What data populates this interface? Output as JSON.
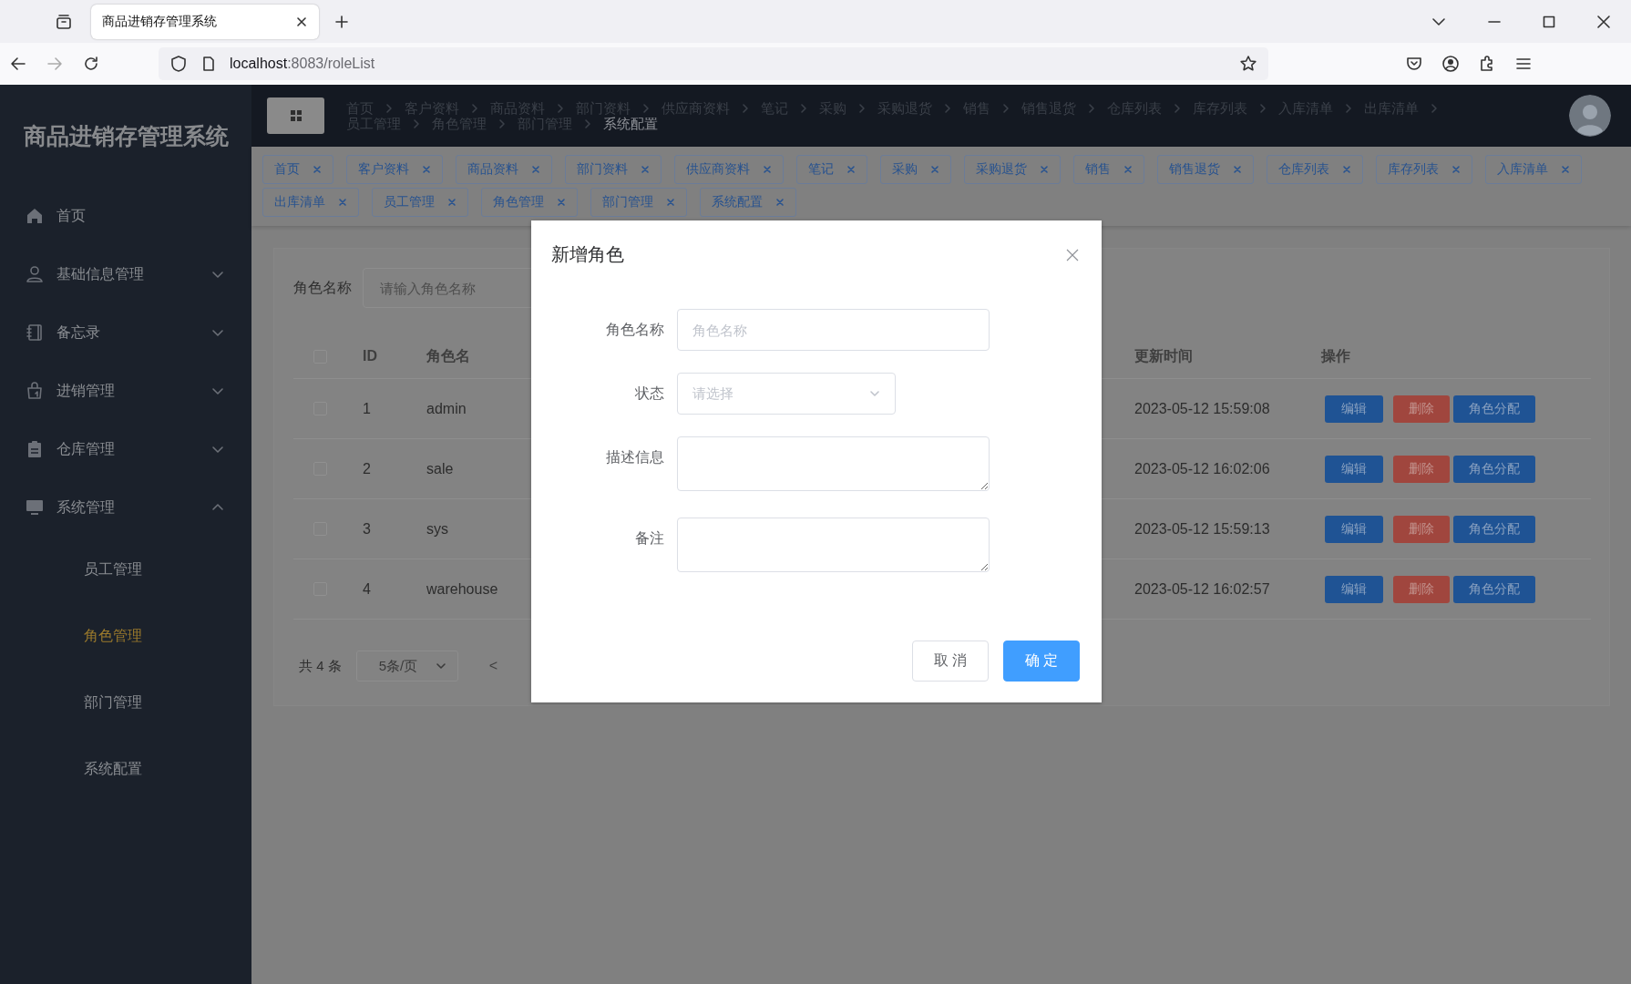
{
  "browser": {
    "tab_title": "商品进销存管理系统",
    "url_host": "localhost",
    "url_path": ":8083/roleList"
  },
  "sidebar": {
    "title": "商品进销存管理系统",
    "items": [
      {
        "label": "首页",
        "kind": "link"
      },
      {
        "label": "基础信息管理",
        "kind": "submenu",
        "expanded": false
      },
      {
        "label": "备忘录",
        "kind": "submenu",
        "expanded": false
      },
      {
        "label": "进销管理",
        "kind": "submenu",
        "expanded": false
      },
      {
        "label": "仓库管理",
        "kind": "submenu",
        "expanded": false
      },
      {
        "label": "系统管理",
        "kind": "submenu",
        "expanded": true,
        "children": [
          {
            "label": "员工管理",
            "selected": false
          },
          {
            "label": "角色管理",
            "selected": true
          },
          {
            "label": "部门管理",
            "selected": false
          },
          {
            "label": "系统配置",
            "selected": false
          }
        ]
      }
    ]
  },
  "breadcrumb": [
    {
      "label": "首页",
      "current": false
    },
    {
      "label": "客户资料",
      "current": false
    },
    {
      "label": "商品资料",
      "current": false
    },
    {
      "label": "部门资料",
      "current": false
    },
    {
      "label": "供应商资料",
      "current": false
    },
    {
      "label": "笔记",
      "current": false
    },
    {
      "label": "采购",
      "current": false
    },
    {
      "label": "采购退货",
      "current": false
    },
    {
      "label": "销售",
      "current": false
    },
    {
      "label": "销售退货",
      "current": false
    },
    {
      "label": "仓库列表",
      "current": false
    },
    {
      "label": "库存列表",
      "current": false
    },
    {
      "label": "入库清单",
      "current": false
    },
    {
      "label": "出库清单",
      "current": false
    },
    {
      "label": "员工管理",
      "current": false
    },
    {
      "label": "角色管理",
      "current": false
    },
    {
      "label": "部门管理",
      "current": false
    },
    {
      "label": "系统配置",
      "current": true
    }
  ],
  "tags": [
    "首页",
    "客户资料",
    "商品资料",
    "部门资料",
    "供应商资料",
    "笔记",
    "采购",
    "采购退货",
    "销售",
    "销售退货",
    "仓库列表",
    "库存列表",
    "入库清单",
    "出库清单",
    "员工管理",
    "角色管理",
    "部门管理",
    "系统配置"
  ],
  "search": {
    "label": "角色名称",
    "placeholder": "请输入角色名称"
  },
  "table": {
    "select_all_checked": false,
    "columns": [
      "ID",
      "角色名",
      "更新时间",
      "操作"
    ],
    "rows": [
      {
        "checked": false,
        "cells": [
          "1",
          "admin",
          "2023-05-12 15:59:08"
        ],
        "actions": [
          {
            "label": "编辑",
            "kind": "edit"
          },
          {
            "label": "删除",
            "kind": "delete"
          },
          {
            "label": "角色分配",
            "kind": "assign"
          }
        ]
      },
      {
        "checked": false,
        "cells": [
          "2",
          "sale",
          "2023-05-12 16:02:06"
        ],
        "actions": [
          {
            "label": "编辑",
            "kind": "edit"
          },
          {
            "label": "删除",
            "kind": "delete"
          },
          {
            "label": "角色分配",
            "kind": "assign"
          }
        ]
      },
      {
        "checked": false,
        "cells": [
          "3",
          "sys",
          "2023-05-12 15:59:13"
        ],
        "actions": [
          {
            "label": "编辑",
            "kind": "edit"
          },
          {
            "label": "删除",
            "kind": "delete"
          },
          {
            "label": "角色分配",
            "kind": "assign"
          }
        ]
      },
      {
        "checked": false,
        "cells": [
          "4",
          "warehouse",
          "2023-05-12 16:02:57"
        ],
        "actions": [
          {
            "label": "编辑",
            "kind": "edit"
          },
          {
            "label": "删除",
            "kind": "delete"
          },
          {
            "label": "角色分配",
            "kind": "assign"
          }
        ]
      }
    ]
  },
  "pagination": {
    "total": "共 4 条",
    "page_size": "5条/页",
    "prev": "<"
  },
  "dialog": {
    "title": "新增角色",
    "fields": [
      {
        "label": "角色名称",
        "kind": "input",
        "placeholder": "角色名称"
      },
      {
        "label": "状态",
        "kind": "select",
        "placeholder": "请选择"
      },
      {
        "label": "描述信息",
        "kind": "textarea"
      },
      {
        "label": "备注",
        "kind": "textarea"
      }
    ],
    "buttons": [
      {
        "label": "取 消",
        "kind": "default"
      },
      {
        "label": "确 定",
        "kind": "primary"
      }
    ]
  }
}
